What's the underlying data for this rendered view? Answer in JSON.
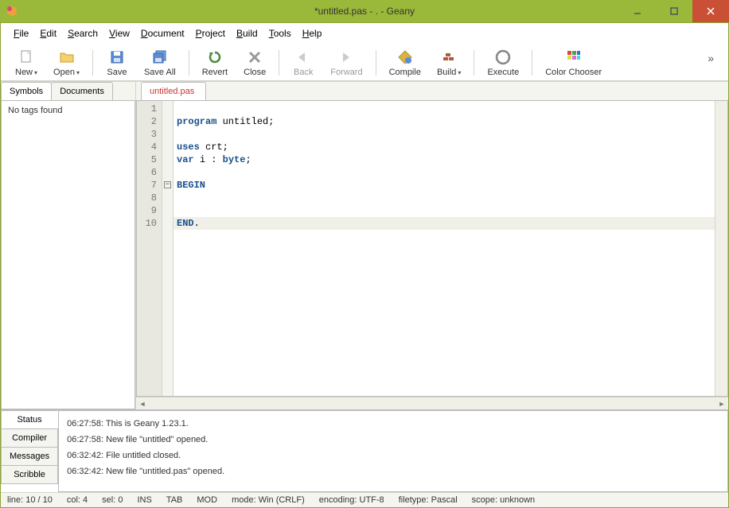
{
  "window": {
    "title": "*untitled.pas - . - Geany"
  },
  "menu": [
    {
      "label": "File",
      "u": 0
    },
    {
      "label": "Edit",
      "u": 0
    },
    {
      "label": "Search",
      "u": 0
    },
    {
      "label": "View",
      "u": 0
    },
    {
      "label": "Document",
      "u": 0
    },
    {
      "label": "Project",
      "u": 0
    },
    {
      "label": "Build",
      "u": 0
    },
    {
      "label": "Tools",
      "u": 0
    },
    {
      "label": "Help",
      "u": 0
    }
  ],
  "toolbar": {
    "new": "New",
    "open": "Open",
    "save": "Save",
    "saveall": "Save All",
    "revert": "Revert",
    "close": "Close",
    "back": "Back",
    "forward": "Forward",
    "compile": "Compile",
    "build": "Build",
    "execute": "Execute",
    "color": "Color Chooser"
  },
  "sidebar": {
    "tabs": [
      "Symbols",
      "Documents"
    ],
    "active": 0,
    "content": "No tags found"
  },
  "editorTabs": [
    "untitled.pas"
  ],
  "code": {
    "lines": [
      {
        "n": 1,
        "text": ""
      },
      {
        "n": 2,
        "segments": [
          {
            "t": "program ",
            "c": "kw"
          },
          {
            "t": "untitled;"
          }
        ]
      },
      {
        "n": 3,
        "text": ""
      },
      {
        "n": 4,
        "segments": [
          {
            "t": "uses ",
            "c": "kw"
          },
          {
            "t": "crt;"
          }
        ]
      },
      {
        "n": 5,
        "segments": [
          {
            "t": "var ",
            "c": "kw"
          },
          {
            "t": "i : "
          },
          {
            "t": "byte",
            "c": "kw"
          },
          {
            "t": ";"
          }
        ]
      },
      {
        "n": 6,
        "text": ""
      },
      {
        "n": 7,
        "segments": [
          {
            "t": "BEGIN",
            "c": "kw"
          }
        ],
        "fold": true
      },
      {
        "n": 8,
        "text": ""
      },
      {
        "n": 9,
        "text": ""
      },
      {
        "n": 10,
        "segments": [
          {
            "t": "END",
            "c": "kw"
          },
          {
            "t": "."
          }
        ],
        "current": true
      }
    ]
  },
  "bottomTabs": [
    "Status",
    "Compiler",
    "Messages",
    "Scribble"
  ],
  "bottomActive": 0,
  "status_log": [
    "06:27:58: This is Geany 1.23.1.",
    "06:27:58: New file \"untitled\" opened.",
    "06:32:42: File untitled closed.",
    "06:32:42: New file \"untitled.pas\" opened."
  ],
  "statusbar": {
    "line": "line: 10 / 10",
    "col": "col: 4",
    "sel": "sel: 0",
    "ins": "INS",
    "tab": "TAB",
    "mod": "MOD",
    "mode": "mode: Win (CRLF)",
    "enc": "encoding: UTF-8",
    "ftype": "filetype: Pascal",
    "scope": "scope: unknown"
  }
}
